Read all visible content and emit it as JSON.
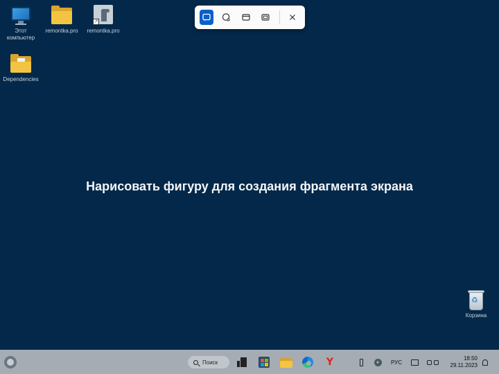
{
  "desktop": {
    "icons": [
      {
        "label": "Этот\nкомпьютер",
        "icon": "computer-icon"
      },
      {
        "label": "remontka.pro",
        "icon": "folder-icon"
      },
      {
        "label": "remontka.pro",
        "icon": "shortcut-icon"
      },
      {
        "label": "Dependencies",
        "icon": "folder-icon"
      },
      {
        "label": "Корзина",
        "icon": "recycle-bin-icon"
      }
    ],
    "background_color": "#03284a"
  },
  "snipping_toolbar": {
    "modes": [
      {
        "name": "rectangle-mode",
        "icon": "rectangle-snip-icon",
        "active": true
      },
      {
        "name": "freeform-mode",
        "icon": "freeform-snip-icon",
        "active": false
      },
      {
        "name": "window-mode",
        "icon": "window-snip-icon",
        "active": false
      },
      {
        "name": "fullscreen-mode",
        "icon": "fullscreen-snip-icon",
        "active": false
      }
    ],
    "close_icon": "close-icon",
    "accent": "#0a5fc9"
  },
  "prompt": {
    "text": "Нарисовать фигуру для создания фрагмента экрана"
  },
  "taskbar": {
    "search_label": "Поиск",
    "language": "РУС",
    "time": "18:50",
    "date": "29.11.2023",
    "apps": [
      "widgets-icon",
      "start-icon",
      "task-view-icon",
      "store-icon",
      "file-explorer-icon",
      "edge-icon",
      "yandex-browser-icon"
    ],
    "tray": [
      "usb-icon",
      "security-icon",
      "display-icon",
      "network-icon",
      "volume-icon",
      "notification-bell-icon"
    ]
  }
}
